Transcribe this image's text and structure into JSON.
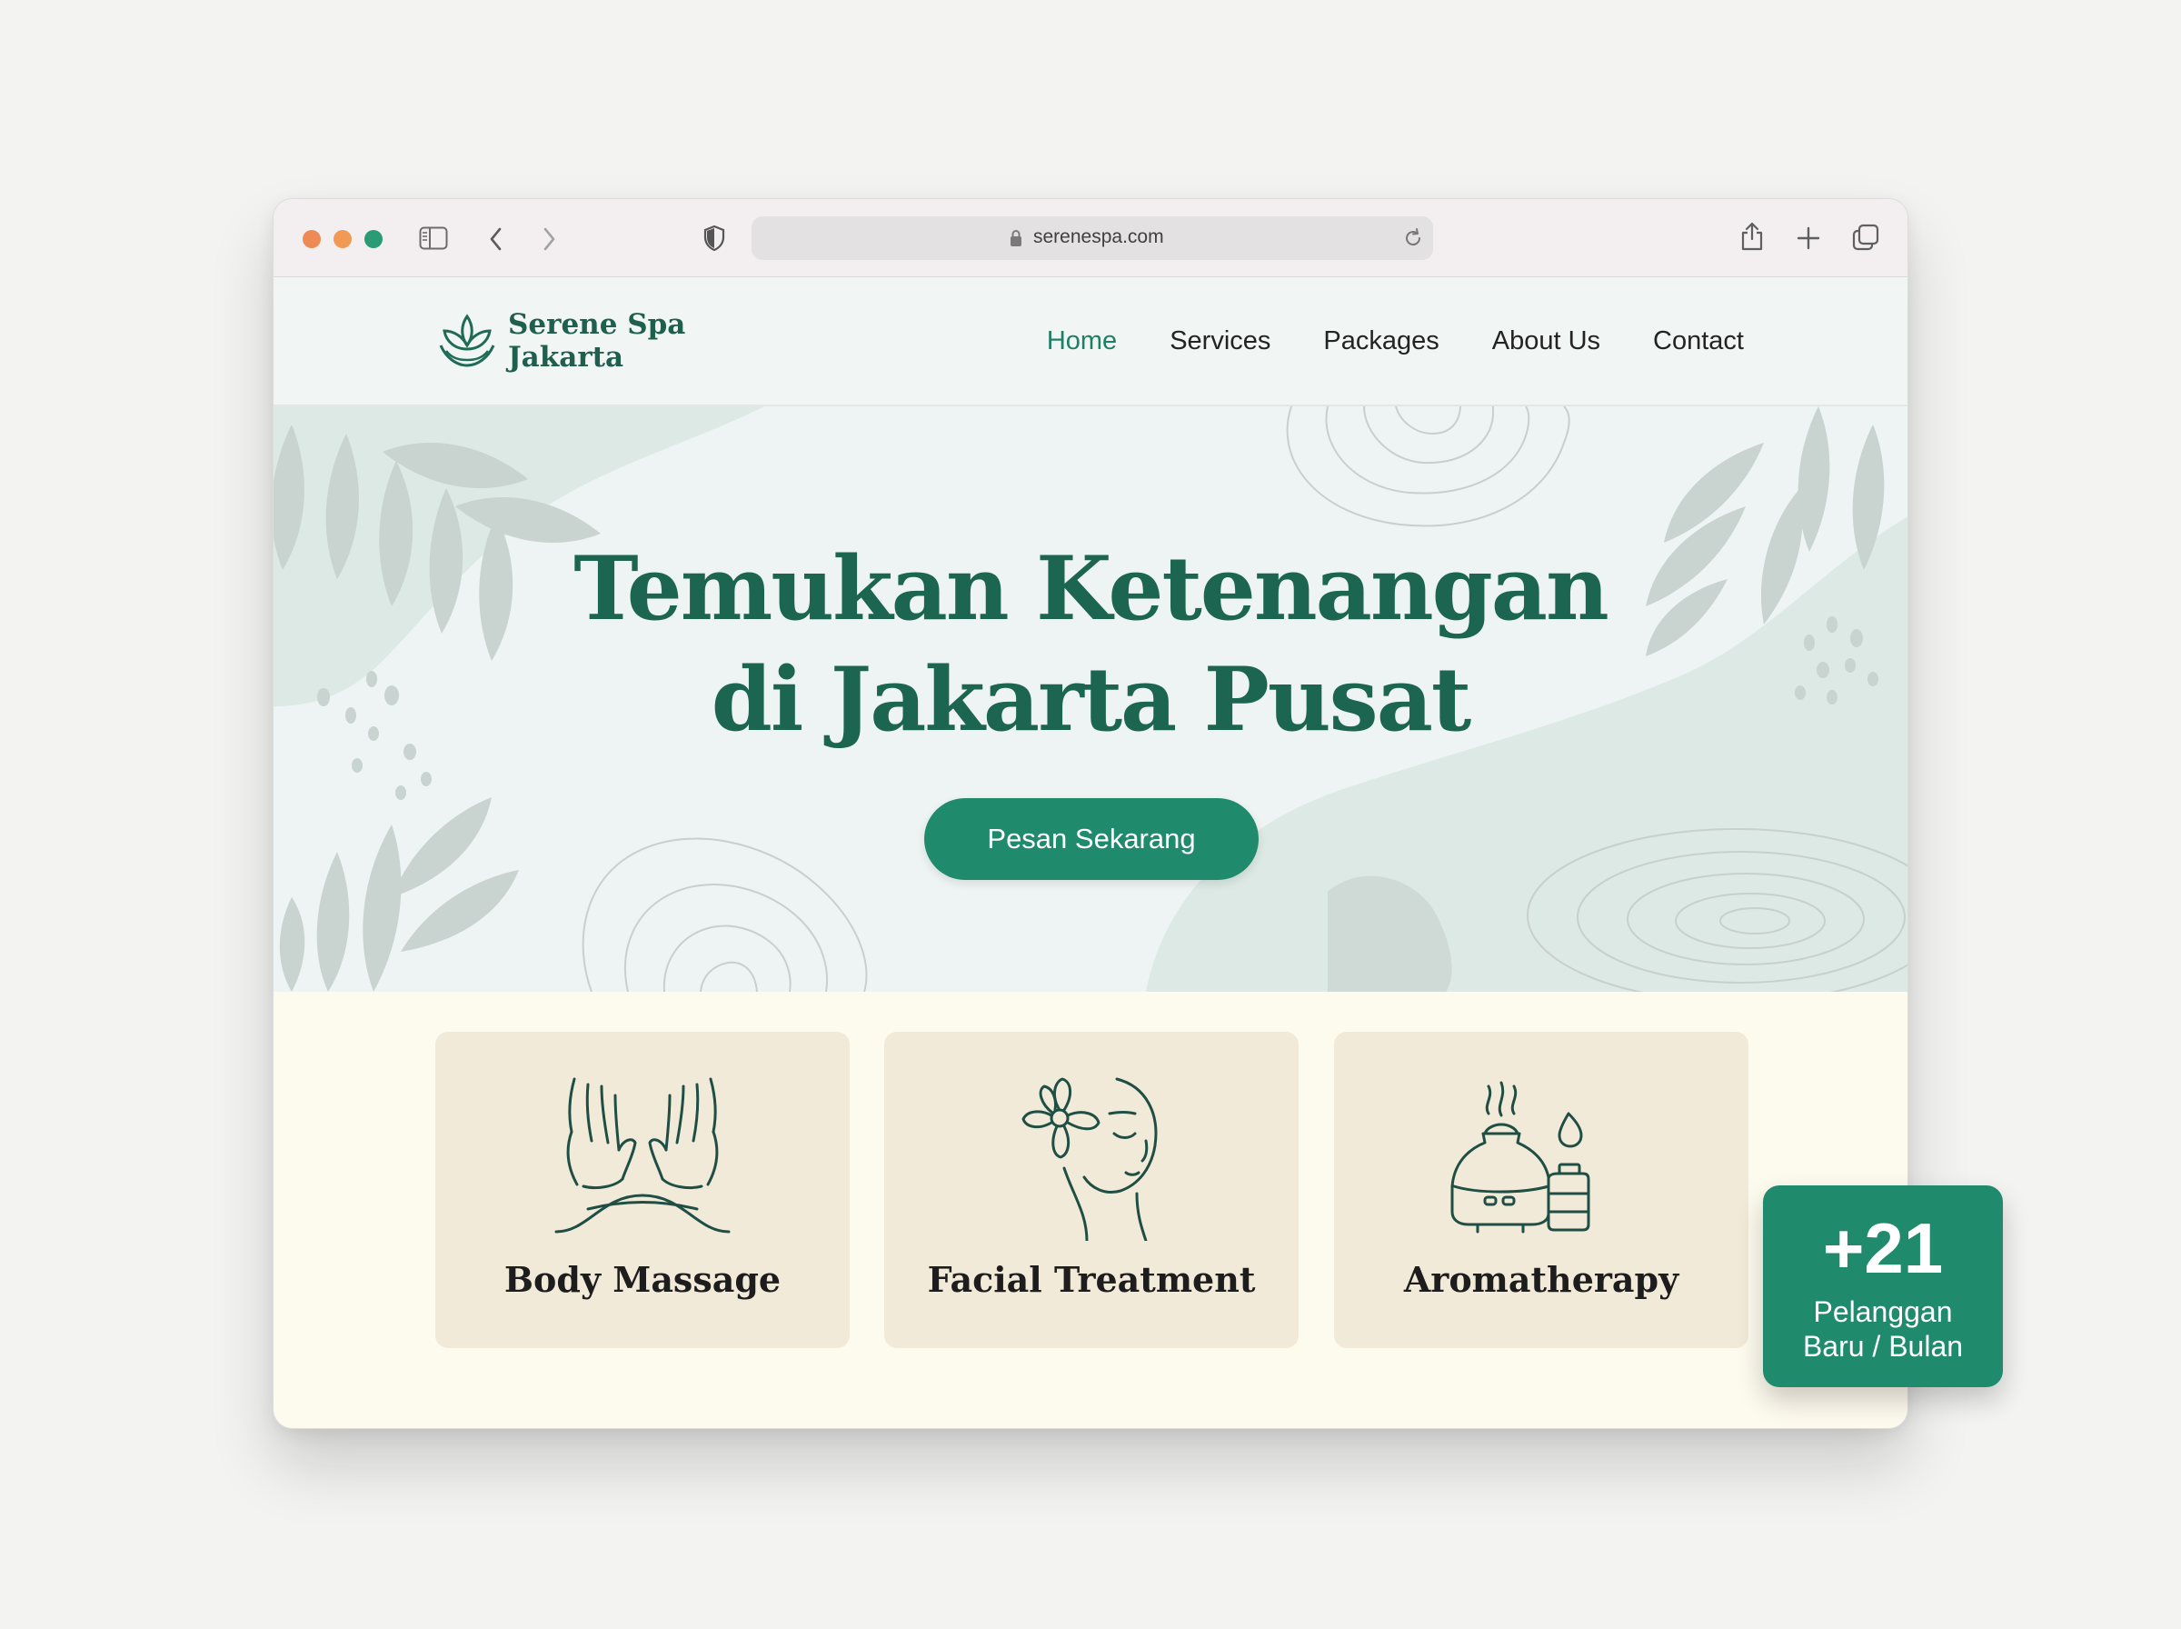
{
  "browser": {
    "url": "serenespa.com",
    "toolbar_icons": [
      "sidebar-icon",
      "back-icon",
      "forward-icon",
      "shield-icon",
      "lock-icon",
      "reload-icon",
      "share-icon",
      "new-tab-icon",
      "tabs-overview-icon"
    ]
  },
  "site": {
    "brand": {
      "line1": "Serene Spa",
      "line2": "Jakarta",
      "logo_icon": "lotus-icon"
    },
    "nav": [
      {
        "label": "Home",
        "active": true
      },
      {
        "label": "Services"
      },
      {
        "label": "Packages"
      },
      {
        "label": "About Us"
      },
      {
        "label": "Contact"
      }
    ]
  },
  "hero": {
    "title_line1": "Temukan Ketenangan",
    "title_line2": "di Jakarta Pusat",
    "cta_label": "Pesan Sekarang"
  },
  "services": [
    {
      "title": "Body Massage",
      "icon": "massage-hands-icon"
    },
    {
      "title": "Facial Treatment",
      "icon": "face-flower-icon"
    },
    {
      "title": "Aromatherapy",
      "icon": "diffuser-icon"
    }
  ],
  "stat_badge": {
    "number": "+21",
    "label_line1": "Pelanggan",
    "label_line2": "Baru / Bulan"
  },
  "colors": {
    "primary": "#1f8a6c",
    "heading": "#1c6651",
    "hero_bg": "#eef4f3",
    "services_bg": "#fdfaee",
    "card_bg": "#f2ead9"
  }
}
